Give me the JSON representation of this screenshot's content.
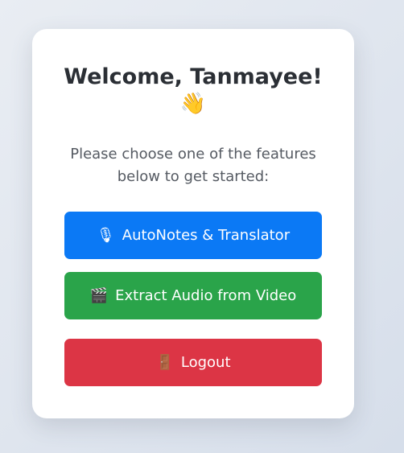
{
  "card": {
    "title": "Welcome, Tanmayee!",
    "title_emoji": "👋",
    "subtitle": "Please choose one of the features below to get started:"
  },
  "buttons": [
    {
      "label": "AutoNotes & Translator",
      "icon": "microphone-icon",
      "glyph": "🎙",
      "color": "#0b79f5"
    },
    {
      "label": "Extract Audio from Video",
      "icon": "clapper-board-icon",
      "glyph": "🎬",
      "color": "#2aa44a"
    },
    {
      "label": "Logout",
      "icon": "door-icon",
      "glyph": "🚪",
      "color": "#dc3545"
    }
  ]
}
